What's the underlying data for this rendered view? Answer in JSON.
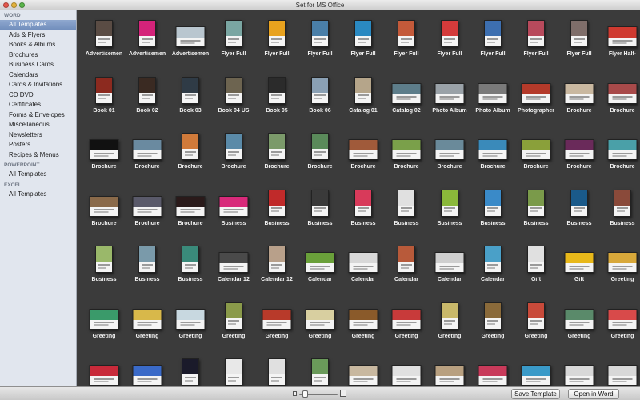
{
  "window": {
    "title": "Set for MS Office"
  },
  "sidebar": {
    "sections": [
      {
        "header": "WORD",
        "items": [
          {
            "label": "All Templates",
            "selected": true
          },
          {
            "label": "Ads & Flyers"
          },
          {
            "label": "Books & Albums"
          },
          {
            "label": "Brochures"
          },
          {
            "label": "Business Cards"
          },
          {
            "label": "Calendars"
          },
          {
            "label": "Cards & Invitations"
          },
          {
            "label": "CD DVD"
          },
          {
            "label": "Certificates"
          },
          {
            "label": "Forms & Envelopes"
          },
          {
            "label": "Miscellaneous"
          },
          {
            "label": "Newsletters"
          },
          {
            "label": "Posters"
          },
          {
            "label": "Recipes & Menus"
          }
        ]
      },
      {
        "header": "POWERPOINT",
        "items": [
          {
            "label": "All Templates"
          }
        ]
      },
      {
        "header": "EXCEL",
        "items": [
          {
            "label": "All Templates"
          }
        ]
      }
    ]
  },
  "templates": {
    "rows": [
      [
        {
          "label": "Advertisemen",
          "o": "p",
          "c": "#5a4c44"
        },
        {
          "label": "Advertisemen",
          "o": "p",
          "c": "#d4237a"
        },
        {
          "label": "Advertisemen",
          "o": "l",
          "c": "#b9c6cf"
        },
        {
          "label": "Flyer Full",
          "o": "p",
          "c": "#7aa6a2"
        },
        {
          "label": "Flyer Full",
          "o": "p",
          "c": "#e8a21e"
        },
        {
          "label": "Flyer Full",
          "o": "p",
          "c": "#4a7fa8"
        },
        {
          "label": "Flyer Full",
          "o": "p",
          "c": "#2a89c1"
        },
        {
          "label": "Flyer Full",
          "o": "p",
          "c": "#c45a3a"
        },
        {
          "label": "Flyer Full",
          "o": "p",
          "c": "#d43b3b"
        },
        {
          "label": "Flyer Full",
          "o": "p",
          "c": "#3d6fb0"
        },
        {
          "label": "Flyer Full",
          "o": "p",
          "c": "#b84a5c"
        },
        {
          "label": "Flyer Full",
          "o": "p",
          "c": "#7f6e6a"
        },
        {
          "label": "Flyer Half-",
          "o": "l",
          "c": "#cf3a30"
        }
      ],
      [
        {
          "label": "Book 01",
          "o": "p",
          "c": "#8c2a1f"
        },
        {
          "label": "Book 02",
          "o": "p",
          "c": "#3a2a22"
        },
        {
          "label": "Book 03",
          "o": "p",
          "c": "#2f3b46"
        },
        {
          "label": "Book 04 US",
          "o": "p",
          "c": "#6d6450"
        },
        {
          "label": "Book 05",
          "o": "p",
          "c": "#2b2b2b"
        },
        {
          "label": "Book 06",
          "o": "p",
          "c": "#8aa0b4"
        },
        {
          "label": "Catalog 01",
          "o": "p",
          "c": "#b5a58a"
        },
        {
          "label": "Catalog 02",
          "o": "l",
          "c": "#5d7d8a"
        },
        {
          "label": "Photo Album",
          "o": "l",
          "c": "#9aa2a8"
        },
        {
          "label": "Photo Album",
          "o": "l",
          "c": "#7a7a7a"
        },
        {
          "label": "Photographer",
          "o": "l",
          "c": "#b43a2a"
        },
        {
          "label": "Brochure",
          "o": "l",
          "c": "#c9b8a0"
        },
        {
          "label": "Brochure",
          "o": "l",
          "c": "#a84a4a"
        }
      ],
      [
        {
          "label": "Brochure",
          "o": "l",
          "c": "#111111"
        },
        {
          "label": "Brochure",
          "o": "l",
          "c": "#6a8aa0"
        },
        {
          "label": "Brochure",
          "o": "p",
          "c": "#d07a3a"
        },
        {
          "label": "Brochure",
          "o": "p",
          "c": "#5a8aa8"
        },
        {
          "label": "Brochure",
          "o": "p",
          "c": "#7b9a6a"
        },
        {
          "label": "Brochure",
          "o": "p",
          "c": "#5a8a5a"
        },
        {
          "label": "Brochure",
          "o": "l",
          "c": "#a05a3a"
        },
        {
          "label": "Brochure",
          "o": "l",
          "c": "#7aa04a"
        },
        {
          "label": "Brochure",
          "o": "l",
          "c": "#6a8a9a"
        },
        {
          "label": "Brochure",
          "o": "l",
          "c": "#3a8aba"
        },
        {
          "label": "Brochure",
          "o": "l",
          "c": "#8aa03a"
        },
        {
          "label": "Brochure",
          "o": "l",
          "c": "#6a2a5a"
        },
        {
          "label": "Brochure",
          "o": "l",
          "c": "#4aa0a8"
        }
      ],
      [
        {
          "label": "Brochure",
          "o": "l",
          "c": "#8a6a4a"
        },
        {
          "label": "Brochure",
          "o": "l",
          "c": "#5a5a6a"
        },
        {
          "label": "Brochure",
          "o": "l",
          "c": "#2a1a1a"
        },
        {
          "label": "Business",
          "o": "l",
          "c": "#d82a7a"
        },
        {
          "label": "Business",
          "o": "p",
          "c": "#c02a2a"
        },
        {
          "label": "Business",
          "o": "p",
          "c": "#3a3a3a"
        },
        {
          "label": "Business",
          "o": "p",
          "c": "#d83a5a"
        },
        {
          "label": "Business",
          "o": "p",
          "c": "#e0e0e0"
        },
        {
          "label": "Business",
          "o": "p",
          "c": "#8ab83a"
        },
        {
          "label": "Business",
          "o": "p",
          "c": "#3a8ac8"
        },
        {
          "label": "Business",
          "o": "p",
          "c": "#7a9a4a"
        },
        {
          "label": "Business",
          "o": "p",
          "c": "#1a5a8a"
        },
        {
          "label": "Business",
          "o": "p",
          "c": "#8a4a3a"
        }
      ],
      [
        {
          "label": "Business",
          "o": "p",
          "c": "#9ab86a"
        },
        {
          "label": "Business",
          "o": "p",
          "c": "#7a9aaa"
        },
        {
          "label": "Business",
          "o": "p",
          "c": "#3a8a7a"
        },
        {
          "label": "Calendar 12",
          "o": "l",
          "c": "#4a4a4a"
        },
        {
          "label": "Calendar 12",
          "o": "p",
          "c": "#b8a08a"
        },
        {
          "label": "Calendar",
          "o": "l",
          "c": "#6aa03a"
        },
        {
          "label": "Calendar",
          "o": "l",
          "c": "#d8d8d8"
        },
        {
          "label": "Calendar",
          "o": "p",
          "c": "#b85a3a"
        },
        {
          "label": "Calendar",
          "o": "l",
          "c": "#cfcfcf"
        },
        {
          "label": "Calendar",
          "o": "p",
          "c": "#4aa0c8"
        },
        {
          "label": "Gift",
          "o": "p",
          "c": "#e0e0e0"
        },
        {
          "label": "Gift",
          "o": "l",
          "c": "#e8b81a"
        },
        {
          "label": "Greeting",
          "o": "l",
          "c": "#d8a83a"
        }
      ],
      [
        {
          "label": "Greeting",
          "o": "l",
          "c": "#3a9a6a"
        },
        {
          "label": "Greeting",
          "o": "l",
          "c": "#d8b84a"
        },
        {
          "label": "Greeting",
          "o": "l",
          "c": "#c8d8e0"
        },
        {
          "label": "Greeting",
          "o": "p",
          "c": "#8a9a4a"
        },
        {
          "label": "Greeting",
          "o": "l",
          "c": "#b83a2a"
        },
        {
          "label": "Greeting",
          "o": "l",
          "c": "#d8cfa0"
        },
        {
          "label": "Greeting",
          "o": "l",
          "c": "#8a5a2a"
        },
        {
          "label": "Greeting",
          "o": "l",
          "c": "#c83a3a"
        },
        {
          "label": "Greeting",
          "o": "p",
          "c": "#c8b86a"
        },
        {
          "label": "Greeting",
          "o": "p",
          "c": "#8a6a3a"
        },
        {
          "label": "Greeting",
          "o": "p",
          "c": "#c84a3a"
        },
        {
          "label": "Greeting",
          "o": "l",
          "c": "#5a8a6a"
        },
        {
          "label": "Greeting",
          "o": "l",
          "c": "#d84a4a"
        }
      ],
      [
        {
          "label": "",
          "o": "l",
          "c": "#c82a3a"
        },
        {
          "label": "",
          "o": "l",
          "c": "#3a6ac8"
        },
        {
          "label": "",
          "o": "p",
          "c": "#1a1a2a"
        },
        {
          "label": "",
          "o": "p",
          "c": "#e8e8e8"
        },
        {
          "label": "",
          "o": "p",
          "c": "#e0e0e0"
        },
        {
          "label": "",
          "o": "p",
          "c": "#6a9a5a"
        },
        {
          "label": "",
          "o": "l",
          "c": "#c8b8a0"
        },
        {
          "label": "",
          "o": "l",
          "c": "#e0e0e0"
        },
        {
          "label": "",
          "o": "l",
          "c": "#b8a080"
        },
        {
          "label": "",
          "o": "l",
          "c": "#c83a5a"
        },
        {
          "label": "",
          "o": "l",
          "c": "#3a9ac8"
        },
        {
          "label": "",
          "o": "l",
          "c": "#d8d8d8"
        },
        {
          "label": "",
          "o": "l",
          "c": "#d8d8d8"
        }
      ]
    ]
  },
  "footer": {
    "save_button": "Save Template",
    "open_button": "Open in Word"
  }
}
